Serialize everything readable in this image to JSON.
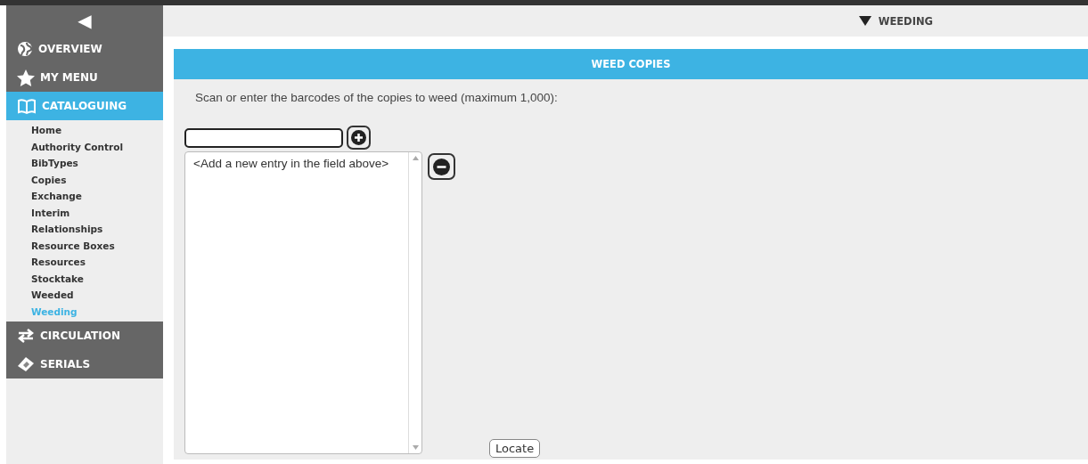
{
  "sidebar": {
    "collapse_icon": "◀",
    "sections": [
      {
        "label": "OVERVIEW",
        "selected": false,
        "expanded": false
      },
      {
        "label": "MY MENU",
        "selected": false,
        "expanded": false
      },
      {
        "label": "CATALOGUING",
        "selected": true,
        "expanded": true,
        "children": [
          {
            "label": "Home",
            "selected": false
          },
          {
            "label": "Authority Control",
            "selected": false
          },
          {
            "label": "BibTypes",
            "selected": false
          },
          {
            "label": "Copies",
            "selected": false
          },
          {
            "label": "Exchange",
            "selected": false
          },
          {
            "label": "Interim",
            "selected": false
          },
          {
            "label": "Relationships",
            "selected": false
          },
          {
            "label": "Resource Boxes",
            "selected": false
          },
          {
            "label": "Resources",
            "selected": false
          },
          {
            "label": "Stocktake",
            "selected": false
          },
          {
            "label": "Weeded",
            "selected": false
          },
          {
            "label": "Weeding",
            "selected": true
          }
        ]
      },
      {
        "label": "CIRCULATION",
        "selected": false,
        "expanded": false
      },
      {
        "label": "SERIALS",
        "selected": false,
        "expanded": false
      }
    ]
  },
  "top_bar": {
    "breadcrumb": "WEEDING"
  },
  "panel": {
    "title": "WEED COPIES",
    "instruction": "Scan or enter the barcodes of the copies to weed (maximum 1,000):",
    "list": {
      "items": [
        "<Add a new entry in the field above>"
      ]
    },
    "locate_button": "Locate"
  }
}
